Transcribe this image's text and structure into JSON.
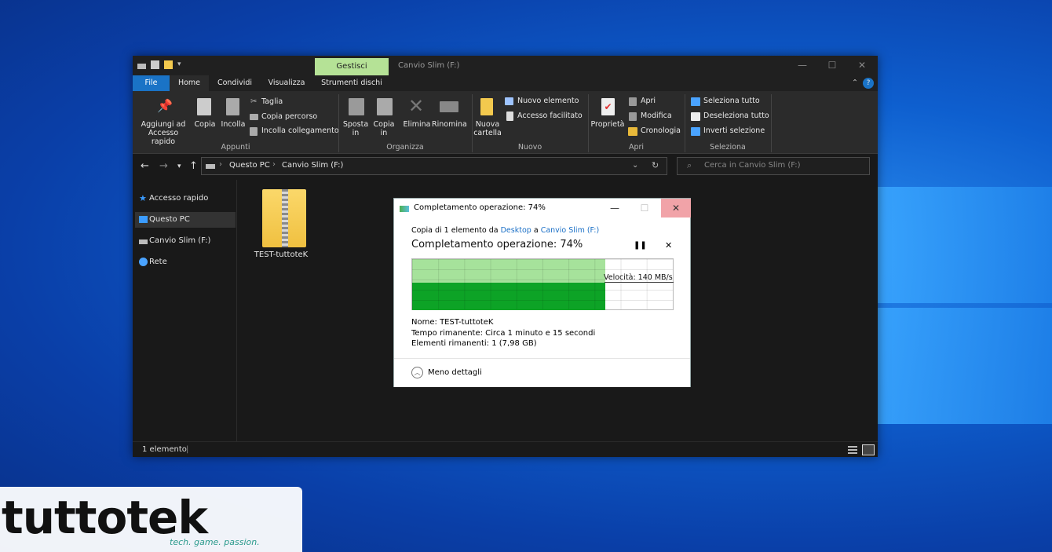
{
  "explorer": {
    "title": "Canvio Slim (F:)",
    "context_tab": "Gestisci",
    "tabs": [
      "File",
      "Home",
      "Condividi",
      "Visualizza",
      "Strumenti dischi"
    ],
    "ribbon": {
      "appunti": {
        "pin": "Aggiungi ad Accesso rapido",
        "copy": "Copia",
        "paste": "Incolla",
        "cut": "Taglia",
        "copy_path": "Copia percorso",
        "paste_link": "Incolla collegamento",
        "group": "Appunti"
      },
      "organizza": {
        "move": "Sposta in",
        "copy_to": "Copia in",
        "delete": "Elimina",
        "rename": "Rinomina",
        "group": "Organizza"
      },
      "nuovo": {
        "new_folder": "Nuova cartella",
        "new_item": "Nuovo elemento",
        "easy_access": "Accesso facilitato",
        "group": "Nuovo"
      },
      "apri": {
        "properties": "Proprietà",
        "open": "Apri",
        "edit": "Modifica",
        "history": "Cronologia",
        "group": "Apri"
      },
      "seleziona": {
        "select_all": "Seleziona tutto",
        "select_none": "Deseleziona tutto",
        "invert": "Inverti selezione",
        "group": "Seleziona"
      }
    },
    "address": {
      "path": [
        "Questo PC",
        "Canvio Slim (F:)"
      ]
    },
    "search": {
      "placeholder": "Cerca in Canvio Slim (F:)"
    },
    "sidebar": [
      {
        "label": "Accesso rapido",
        "icon": "star-icon"
      },
      {
        "label": "Questo PC",
        "icon": "computer-icon",
        "selected": true
      },
      {
        "label": "Canvio Slim (F:)",
        "icon": "drive-icon"
      },
      {
        "label": "Rete",
        "icon": "network-icon"
      }
    ],
    "files": [
      {
        "name": "TEST-tuttoteK",
        "icon": "zip-folder-icon"
      }
    ],
    "status": "1 elemento"
  },
  "dialog": {
    "title": "Completamento operazione: 74%",
    "copy_prefix": "Copia di 1 elemento da",
    "source": "Desktop",
    "to": "a",
    "dest": "Canvio Slim (F:)",
    "heading": "Completamento operazione: 74%",
    "progress": 0.74,
    "speed": "Velocità: 140 MB/s",
    "name_label": "Nome:",
    "name": "TEST-tuttoteK",
    "time_label": "Tempo rimanente:",
    "time": "Circa 1 minuto e 15 secondi",
    "items_label": "Elementi rimanenti:",
    "items": "1 (7,98 GB)",
    "less_details": "Meno dettagli"
  },
  "watermark": {
    "brand": "tuttotek",
    "tagline": "tech. game. passion."
  }
}
